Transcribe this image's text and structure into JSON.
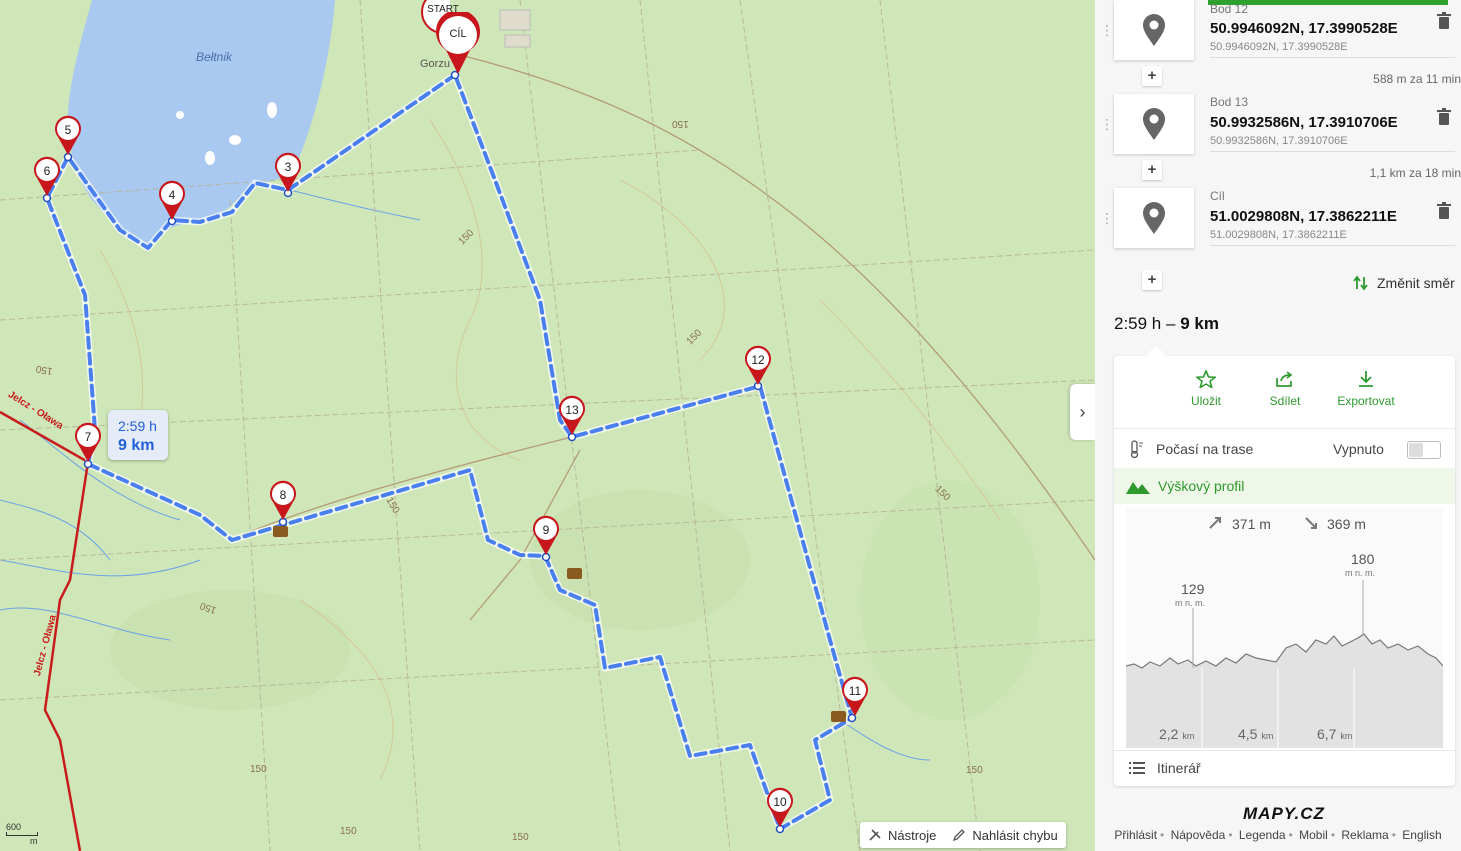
{
  "map": {
    "lake_name": "Bełtnik",
    "town_label": "Gorzu",
    "road_label_1": "Jelcz - Oława",
    "road_label_2": "Jelcz - Oława",
    "contour_labels": [
      "150",
      "150",
      "150",
      "150",
      "150",
      "150",
      "150",
      "150",
      "150",
      "150",
      "150"
    ],
    "markers": [
      {
        "label": "START"
      },
      {
        "label": "CÍL"
      },
      {
        "label": "3"
      },
      {
        "label": "4"
      },
      {
        "label": "5"
      },
      {
        "label": "6"
      },
      {
        "label": "7"
      },
      {
        "label": "8"
      },
      {
        "label": "9"
      },
      {
        "label": "10"
      },
      {
        "label": "11"
      },
      {
        "label": "12"
      },
      {
        "label": "13"
      }
    ],
    "route_bubble": {
      "time": "2:59 h",
      "distance": "9 km"
    },
    "tools": {
      "nastroje": "Nástroje",
      "report": "Nahlásit chybu"
    },
    "scale": {
      "value": "600",
      "unit": "m"
    },
    "collapse_icon": "›",
    "route_color": "#4a7ff0",
    "marker_color": "#c8161d"
  },
  "panel": {
    "waypoints": [
      {
        "name": "Bod 12",
        "coord": "50.9946092N, 17.3990528E",
        "coord_small": "50.9946092N, 17.3990528E"
      },
      {
        "name": "Bod 13",
        "coord": "50.9932586N, 17.3910706E",
        "coord_small": "50.9932586N, 17.3910706E"
      },
      {
        "name": "Cíl",
        "coord": "51.0029808N, 17.3862211E",
        "coord_small": "51.0029808N, 17.3862211E"
      }
    ],
    "segments": [
      "588 m za 11 min",
      "1,1 km za 18 min"
    ],
    "plus_label": "+",
    "change_direction": "Změnit směr",
    "summary_time": "2:59 h",
    "summary_dash": "–",
    "summary_distance": "9 km",
    "actions": [
      {
        "label": "Uložit"
      },
      {
        "label": "Sdílet"
      },
      {
        "label": "Exportovat"
      }
    ],
    "weather_label": "Počasí na trase",
    "weather_state": "Vypnuto",
    "elevation_title": "Výškový profil",
    "ascent": "371 m",
    "descent": "369 m",
    "min_elev": "129",
    "max_elev": "180",
    "elev_unit": "m n. m.",
    "x_ticks": [
      {
        "v": "2,2",
        "u": "km"
      },
      {
        "v": "4,5",
        "u": "km"
      },
      {
        "v": "6,7",
        "u": "km"
      }
    ],
    "itinerary": "Itinerář",
    "logo": "MAPY.CZ",
    "footer_links": [
      "Přihlásit",
      "Nápověda",
      "Legenda",
      "Mobil",
      "Reklama",
      "English"
    ],
    "accent": "#2e9a2e"
  }
}
